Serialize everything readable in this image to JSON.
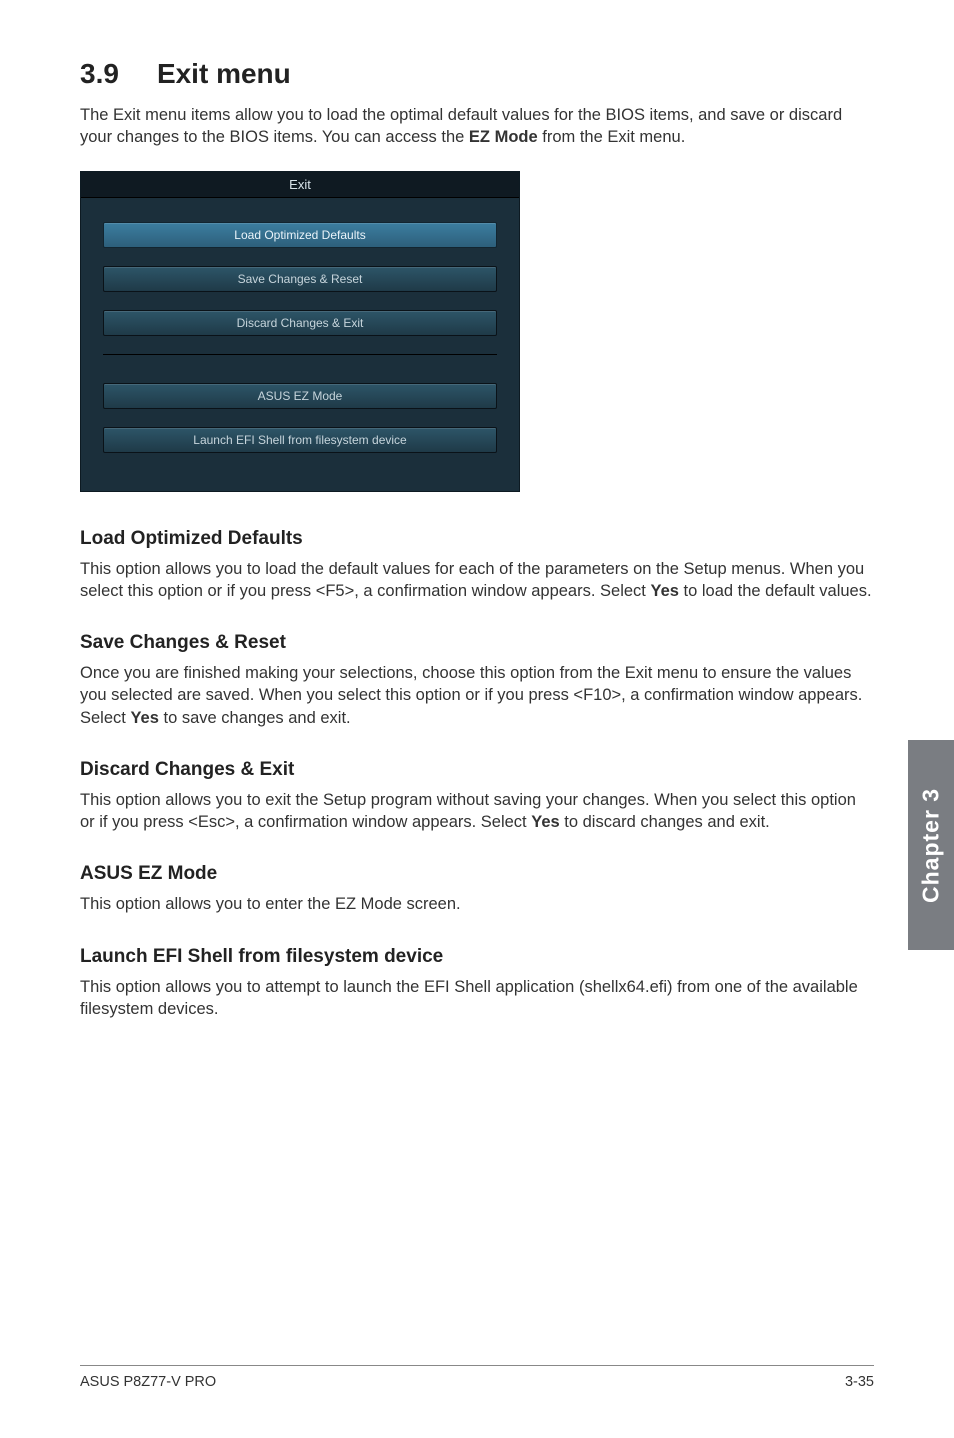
{
  "heading": {
    "number": "3.9",
    "title": "Exit menu"
  },
  "intro": {
    "line1": "The Exit menu items allow you to load the optimal default values for the BIOS items, and save or discard your changes to the BIOS items. You can access the ",
    "bold1": "EZ Mode",
    "line2": " from the Exit menu."
  },
  "bios": {
    "tab": "Exit",
    "load_defaults": "Load Optimized Defaults",
    "save_reset": "Save Changes & Reset",
    "discard_exit": "Discard Changes & Exit",
    "ez_mode": "ASUS EZ Mode",
    "launch_efi": "Launch EFI Shell from filesystem device"
  },
  "sections": {
    "load_defaults": {
      "title": "Load Optimized Defaults",
      "p1": "This option allows you to load the default values for each of the parameters on the Setup menus. When you select this option or if you press <F5>, a confirmation window appears. Select ",
      "bold": "Yes",
      "p2": " to load the default values."
    },
    "save_reset": {
      "title": "Save Changes & Reset",
      "p1": "Once you are finished making your selections, choose this option from the Exit menu to ensure the values you selected are saved. When you select this option or if you press <F10>, a confirmation window appears. Select ",
      "bold": "Yes",
      "p2": " to save changes and exit."
    },
    "discard_exit": {
      "title": "Discard Changes & Exit",
      "p1": "This option allows you to exit the Setup program without saving your changes. When you select this option or if you press <Esc>, a confirmation window appears. Select ",
      "bold": "Yes",
      "p2": " to discard changes and exit."
    },
    "ez_mode": {
      "title": "ASUS EZ Mode",
      "p": "This option allows you to enter the EZ Mode screen."
    },
    "launch_efi": {
      "title": "Launch EFI Shell from filesystem device",
      "p": "This option allows you to attempt to launch the EFI Shell application (shellx64.efi) from one of the available filesystem devices."
    }
  },
  "sidebar": "Chapter 3",
  "footer": {
    "left": "ASUS P8Z77-V PRO",
    "right": "3-35"
  }
}
